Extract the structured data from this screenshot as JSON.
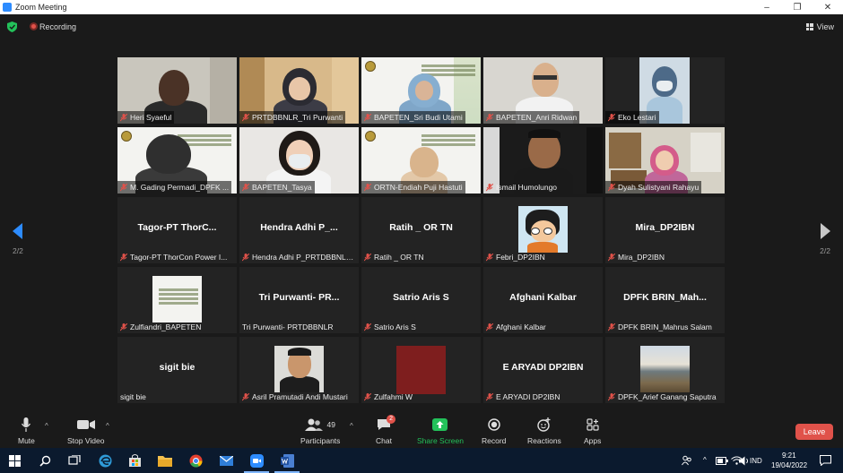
{
  "window": {
    "title": "Zoom Meeting",
    "controls": [
      "–",
      "❐",
      "✕"
    ]
  },
  "topbar": {
    "recording_label": "Recording",
    "view_label": "View"
  },
  "pager": {
    "left_label": "2/2",
    "right_label": "2/2"
  },
  "tiles": [
    {
      "name": "Heri Syaeful",
      "center": ""
    },
    {
      "name": "PRTDBBNLR_Tri Purwanti",
      "center": ""
    },
    {
      "name": "BAPETEN_Sri Budi Utami",
      "center": ""
    },
    {
      "name": "BAPETEN_Anri Ridwan",
      "center": ""
    },
    {
      "name": "Eko Lestari",
      "center": ""
    },
    {
      "name": "M. Gading Permadi_DPFK ...",
      "center": ""
    },
    {
      "name": "BAPETEN_Tasya",
      "center": ""
    },
    {
      "name": "ORTN-Endiah Puji Hastuti",
      "center": ""
    },
    {
      "name": "Ismail Humolungo",
      "center": ""
    },
    {
      "name": "Dyah Sulistyani Rahayu",
      "center": ""
    },
    {
      "name": "Tagor-PT ThorCon Power I...",
      "center": "Tagor-PT  ThorC..."
    },
    {
      "name": "Hendra Adhi P_PRTDBBNLR...",
      "center": "Hendra  Adhi  P_..."
    },
    {
      "name": "Ratih _ OR TN",
      "center": "Ratih _ OR TN"
    },
    {
      "name": "Febri_DP2IBN",
      "center": ""
    },
    {
      "name": "Mira_DP2IBN",
      "center": "Mira_DP2IBN"
    },
    {
      "name": "Zulfiandri_BAPETEN",
      "center": ""
    },
    {
      "name": "Tri Purwanti- PRTDBBNLR",
      "center": "Tri  Purwanti-  PR..."
    },
    {
      "name": "Satrio Aris S",
      "center": "Satrio Aris S"
    },
    {
      "name": "Afghani Kalbar",
      "center": "Afghani Kalbar"
    },
    {
      "name": "DPFK BRIN_Mahrus Salam",
      "center": "DPFK  BRIN_Mah..."
    },
    {
      "name": "sigit bie",
      "center": "sigit bie"
    },
    {
      "name": "Asril Pramutadi Andi Mustari",
      "center": ""
    },
    {
      "name": "Zulfahmi W",
      "center": ""
    },
    {
      "name": "E ARYADI DP2IBN",
      "center": "E ARYADI DP2IBN"
    },
    {
      "name": "DPFK_Arief Ganang Saputra",
      "center": ""
    }
  ],
  "toolbar": {
    "mute": "Mute",
    "stop_video": "Stop Video",
    "participants": "Participants",
    "participants_count": "49",
    "chat": "Chat",
    "chat_badge": "2",
    "share_screen": "Share Screen",
    "record": "Record",
    "reactions": "Reactions",
    "apps": "Apps",
    "leave": "Leave"
  },
  "taskbar": {
    "language": "IND",
    "time": "9:21",
    "date": "19/04/2022"
  },
  "colors": {
    "accent": "#2d8cff",
    "share_green": "#23c15a",
    "leave_red": "#e0524a",
    "background": "#1a1a1a"
  }
}
